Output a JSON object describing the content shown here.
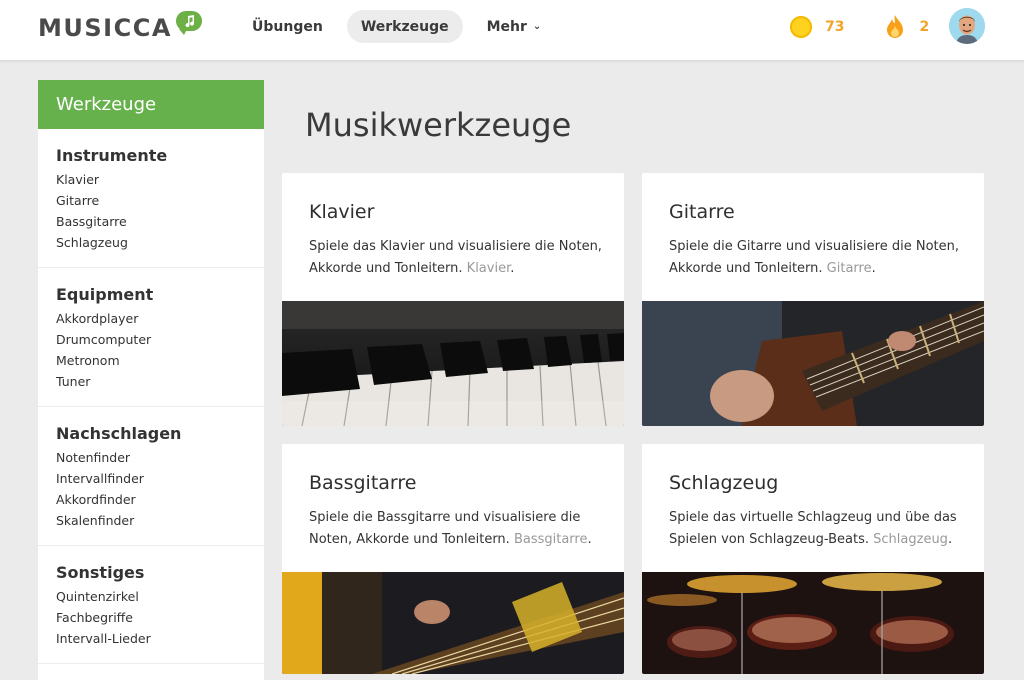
{
  "header": {
    "logo": "MUSICCA",
    "nav": [
      {
        "label": "Übungen"
      },
      {
        "label": "Werkzeuge"
      },
      {
        "label": "Mehr"
      }
    ],
    "coins": "73",
    "streak": "2"
  },
  "sidebar": {
    "title": "Werkzeuge",
    "sections": [
      {
        "title": "Instrumente",
        "links": [
          "Klavier",
          "Gitarre",
          "Bassgitarre",
          "Schlagzeug"
        ]
      },
      {
        "title": "Equipment",
        "links": [
          "Akkordplayer",
          "Drumcomputer",
          "Metronom",
          "Tuner"
        ]
      },
      {
        "title": "Nachschlagen",
        "links": [
          "Notenfinder",
          "Intervallfinder",
          "Akkordfinder",
          "Skalenfinder"
        ]
      },
      {
        "title": "Sonstiges",
        "links": [
          "Quintenzirkel",
          "Fachbegriffe",
          "Intervall-Lieder"
        ]
      }
    ]
  },
  "main": {
    "title": "Musikwerkzeuge",
    "cards": [
      {
        "title": "Klavier",
        "desc": "Spiele das Klavier und visualisiere die Noten, Akkorde und Tonleitern.",
        "link": "Klavier"
      },
      {
        "title": "Gitarre",
        "desc": "Spiele die Gitarre und visualisiere die Noten, Akkorde und Tonleitern.",
        "link": "Gitarre"
      },
      {
        "title": "Bassgitarre",
        "desc": "Spiele die Bassgitarre und visualisiere die Noten, Akkorde und Tonleitern.",
        "link": "Bassgitarre"
      },
      {
        "title": "Schlagzeug",
        "desc": "Spiele das virtuelle Schlagzeug und übe das Spielen von Schlagzeug-Beats.",
        "link": "Schlagzeug"
      }
    ]
  },
  "colors": {
    "brand_green": "#67b14c",
    "coin": "#ffd21f",
    "stat_orange": "#f0a52a"
  }
}
